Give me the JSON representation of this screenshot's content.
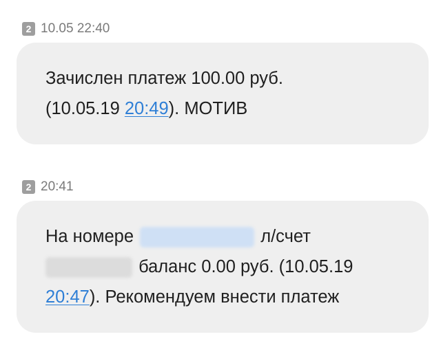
{
  "messages": [
    {
      "sim": "2",
      "time": "10.05 22:40",
      "text_1": "Зачислен платеж 100.00 руб.",
      "text_2a": "(10.05.19 ",
      "link_time": "20:49",
      "text_2b": "). МОТИВ"
    },
    {
      "sim": "2",
      "time": "20:41",
      "text_1a": "На номере ",
      "text_1b": " л/счет",
      "text_2": " баланс 0.00 руб. (10.05.19",
      "link_time": "20:47",
      "text_3": "). Рекомендуем внести платеж"
    }
  ],
  "colors": {
    "bubble": "#efefef",
    "link": "#2f7fd6",
    "badge": "#9e9e9e",
    "meta_text": "#7a7a7a"
  }
}
